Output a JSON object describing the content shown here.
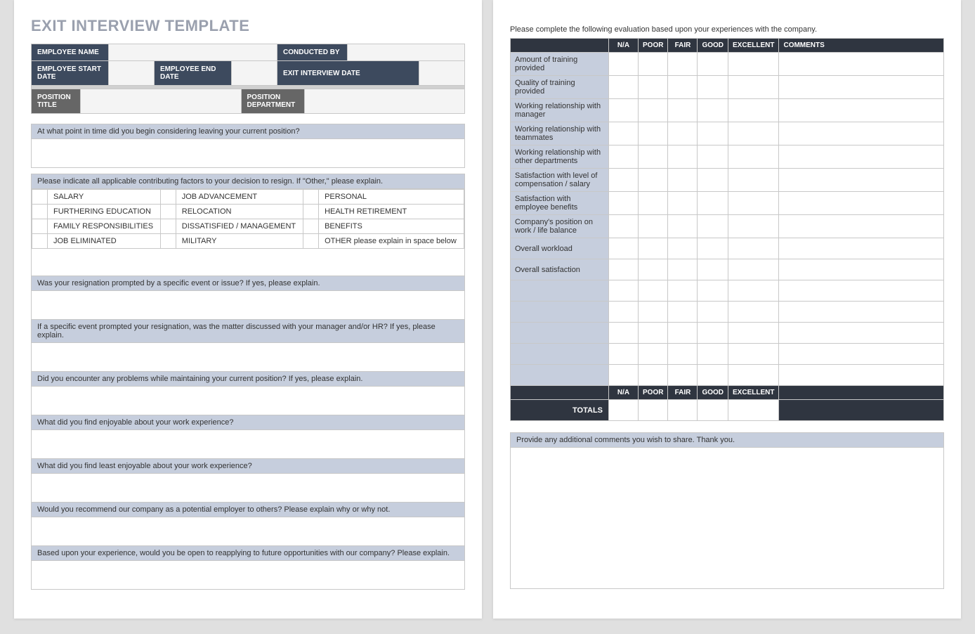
{
  "title": "EXIT INTERVIEW TEMPLATE",
  "header": {
    "employee_name_label": "EMPLOYEE NAME",
    "conducted_by_label": "CONDUCTED BY",
    "start_date_label": "EMPLOYEE START DATE",
    "end_date_label": "EMPLOYEE END DATE",
    "exit_date_label": "EXIT INTERVIEW DATE",
    "position_title_label": "POSITION TITLE",
    "position_dept_label": "POSITION DEPARTMENT",
    "employee_name": "",
    "conducted_by": "",
    "start_date": "",
    "end_date": "",
    "exit_date": "",
    "position_title": "",
    "position_dept": ""
  },
  "q1": {
    "prompt": "At what point in time did you begin considering leaving your current position?"
  },
  "factors_prompt": "Please indicate all applicable contributing factors to your decision to resign. If \"Other,\" please explain.",
  "factors": {
    "r0c0": "SALARY",
    "r0c1": "JOB ADVANCEMENT",
    "r0c2": "PERSONAL",
    "r1c0": "FURTHERING EDUCATION",
    "r1c1": "RELOCATION",
    "r1c2": "HEALTH RETIREMENT",
    "r2c0": "FAMILY RESPONSIBILITIES",
    "r2c1": "DISSATISFIED / MANAGEMENT",
    "r2c2": "BENEFITS",
    "r3c0": "JOB ELIMINATED",
    "r3c1": "MILITARY",
    "r3c2": "OTHER please explain in space below"
  },
  "q2": {
    "prompt": "Was your resignation prompted by a specific event or issue? If yes, please explain."
  },
  "q3": {
    "prompt": "If a specific event prompted your resignation, was the matter discussed with your manager and/or HR? If yes, please explain."
  },
  "q4": {
    "prompt": "Did you encounter any problems while maintaining your current position?  If yes, please explain."
  },
  "q5": {
    "prompt": "What did you find enjoyable about your work experience?"
  },
  "q6": {
    "prompt": "What did you find least enjoyable about your work experience?"
  },
  "q7": {
    "prompt": "Would you recommend our company as a potential employer to others? Please explain why or why not."
  },
  "q8": {
    "prompt": "Based upon your experience, would you be open to reapplying to future opportunities with our company?  Please explain."
  },
  "page2_intro": "Please complete the following evaluation based upon your experiences with the company.",
  "eval_headers": {
    "na": "N/A",
    "poor": "POOR",
    "fair": "FAIR",
    "good": "GOOD",
    "excellent": "EXCELLENT",
    "comments": "COMMENTS"
  },
  "eval_rows": [
    "Amount of training provided",
    "Quality of training provided",
    "Working relationship with manager",
    "Working relationship with teammates",
    "Working relationship with other departments",
    "Satisfaction with level of compensation / salary",
    "Satisfaction with employee benefits",
    "Company's position on work / life balance",
    "Overall workload",
    "Overall satisfaction",
    "",
    "",
    "",
    "",
    ""
  ],
  "totals_label": "TOTALS",
  "additional": {
    "prompt": "Provide any additional comments you wish to share.  Thank you."
  }
}
